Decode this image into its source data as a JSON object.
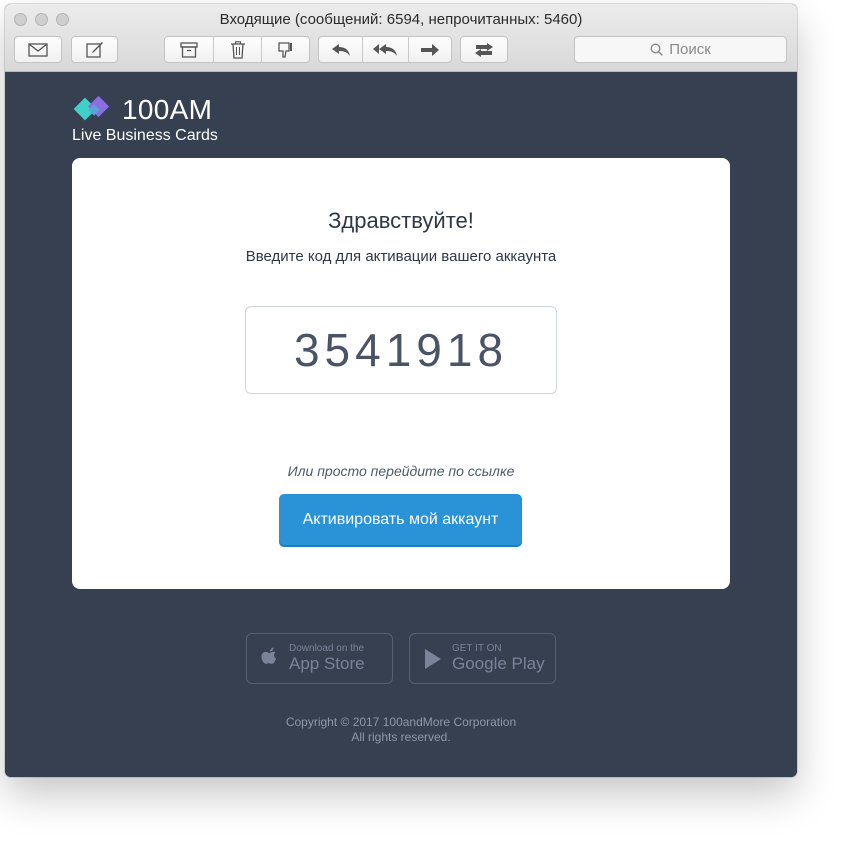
{
  "window": {
    "title": "Входящие (сообщений: 6594, непрочитанных: 5460)"
  },
  "toolbar": {
    "search_placeholder": "Поиск",
    "icons": [
      "compose-envelope-icon",
      "new-message-icon",
      "archive-icon",
      "trash-icon",
      "junk-icon",
      "reply-icon",
      "reply-all-icon",
      "forward-icon",
      "move-icon",
      "search-icon"
    ]
  },
  "brand": {
    "name": "100AM",
    "tagline": "Live Business Cards",
    "colors": {
      "accent_cyan": "#3fd0c9",
      "accent_purple": "#8b6ee0"
    }
  },
  "email": {
    "greeting": "Здравствуйте!",
    "instruction": "Введите код для активации вашего аккаунта",
    "activation_code": "3541918",
    "alternative_text": "Или просто перейдите по ссылке",
    "activate_button": "Активировать мой аккаунт",
    "button_color": "#2a93d8"
  },
  "stores": {
    "appstore_small": "Download on the",
    "appstore_big": "App Store",
    "googleplay_small": "GET IT ON",
    "googleplay_big": "Google Play"
  },
  "footer": {
    "copyright": "Copyright © 2017 100andMore Corporation",
    "rights": "All rights reserved."
  }
}
